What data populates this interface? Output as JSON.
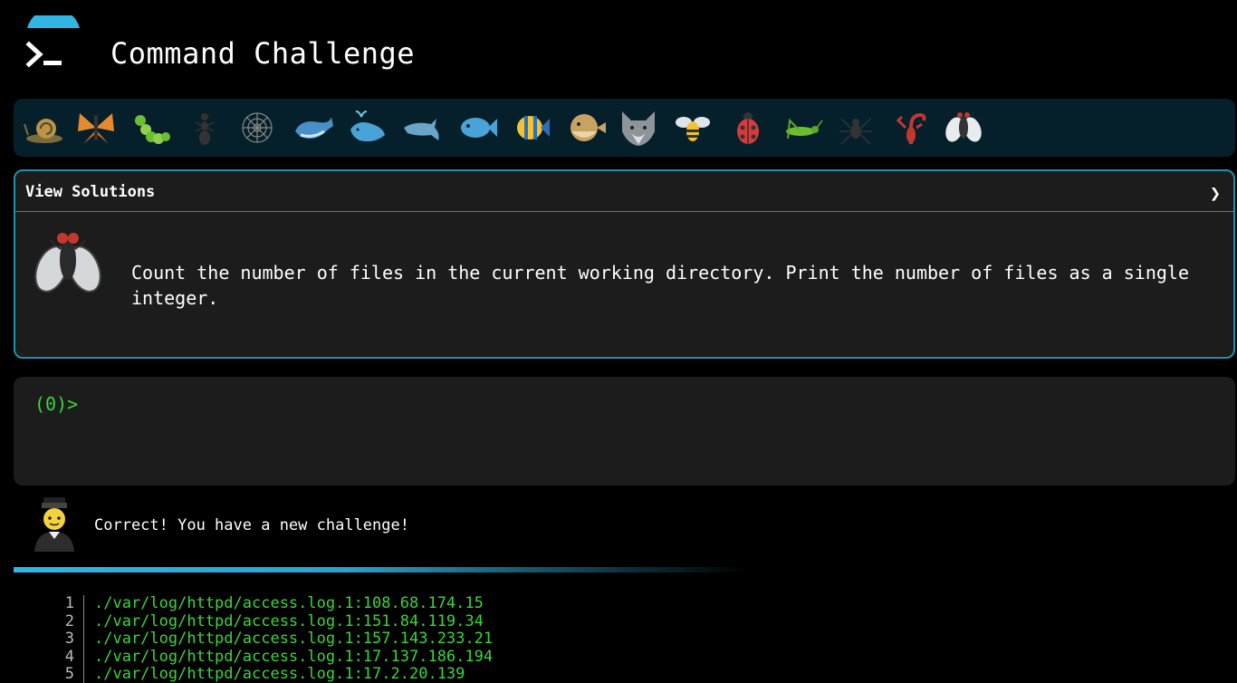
{
  "header": {
    "title": "Command Challenge"
  },
  "animals": [
    {
      "name": "snail-icon"
    },
    {
      "name": "butterfly-icon"
    },
    {
      "name": "caterpillar-icon"
    },
    {
      "name": "ant-icon"
    },
    {
      "name": "spider-web-icon"
    },
    {
      "name": "whale-icon"
    },
    {
      "name": "spouting-whale-icon"
    },
    {
      "name": "dolphin-icon"
    },
    {
      "name": "fish-icon"
    },
    {
      "name": "tropical-fish-icon"
    },
    {
      "name": "blowfish-icon"
    },
    {
      "name": "wolf-icon"
    },
    {
      "name": "bee-icon"
    },
    {
      "name": "ladybug-icon"
    },
    {
      "name": "cricket-icon"
    },
    {
      "name": "spider-icon"
    },
    {
      "name": "scorpion-icon"
    },
    {
      "name": "fly-icon"
    }
  ],
  "challenge": {
    "solutions_label": "View Solutions",
    "toggle_glyph": "❯",
    "text": "Count the number of files in the current working directory. Print the number of files as a single integer."
  },
  "terminal": {
    "prompt": "(0)>"
  },
  "feedback": {
    "message": "Correct! You have a new challenge!"
  },
  "output": {
    "lines": [
      {
        "num": "1",
        "text": "./var/log/httpd/access.log.1:108.68.174.15"
      },
      {
        "num": "2",
        "text": "./var/log/httpd/access.log.1:151.84.119.34"
      },
      {
        "num": "3",
        "text": "./var/log/httpd/access.log.1:157.143.233.21"
      },
      {
        "num": "4",
        "text": "./var/log/httpd/access.log.1:17.137.186.194"
      },
      {
        "num": "5",
        "text": "./var/log/httpd/access.log.1:17.2.20.139"
      }
    ]
  },
  "colors": {
    "accent": "#1f8fb0",
    "prompt_green": "#39d739",
    "panel": "#1c1c1c",
    "animal_bar": "#06202b"
  }
}
